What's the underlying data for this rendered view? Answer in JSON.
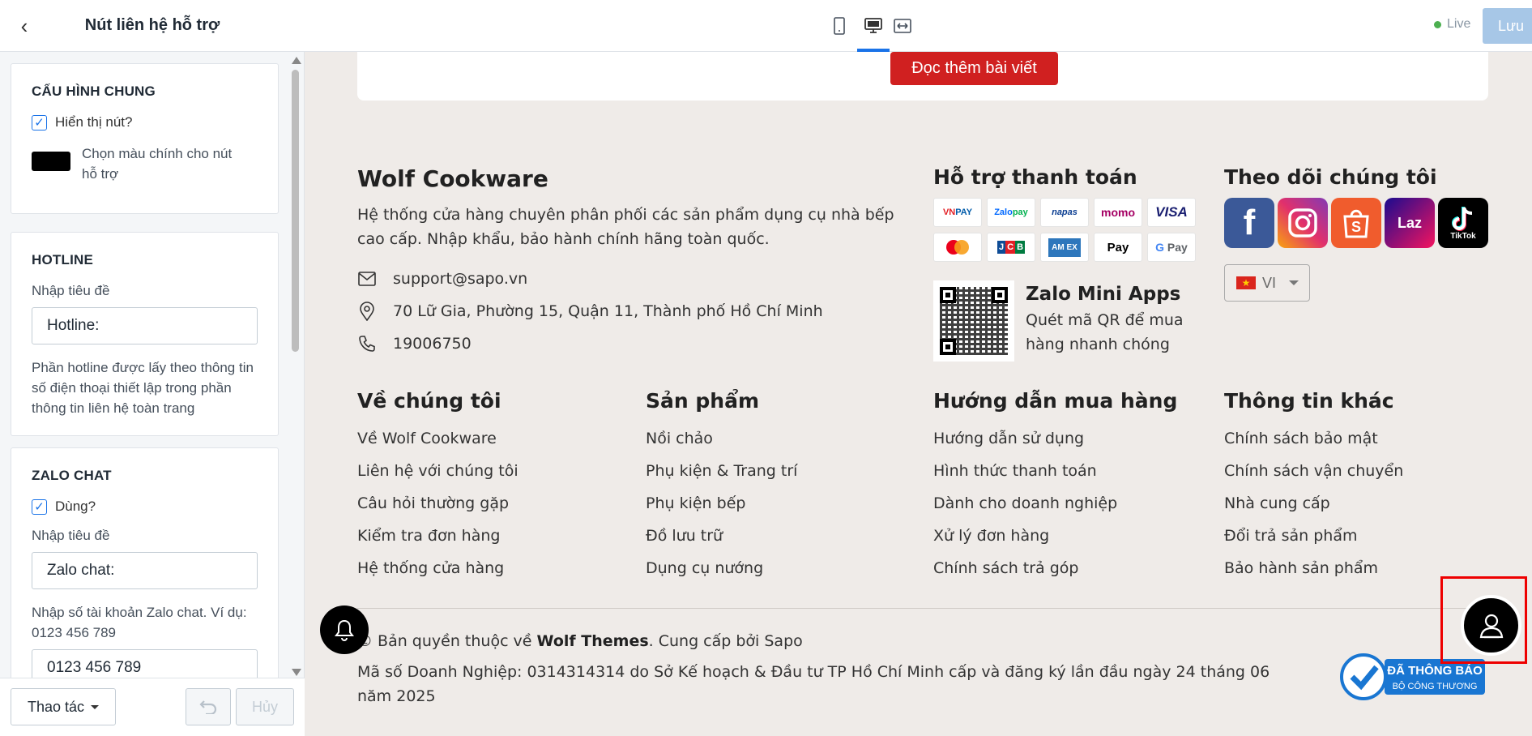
{
  "panel": {
    "title": "Nút liên hệ hỗ trợ",
    "general": {
      "heading": "CẤU HÌNH CHUNG",
      "show_button_label": "Hiển thị nút?",
      "show_button_checked": true,
      "color_label": "Chọn màu chính cho nút hỗ trợ",
      "color_value": "#000000"
    },
    "hotline": {
      "heading": "HOTLINE",
      "title_label": "Nhập tiêu đề",
      "title_value": "Hotline:",
      "help": "Phần hotline được lấy theo thông tin số điện thoại thiết lập trong phần thông tin liên hệ toàn trang"
    },
    "zalo": {
      "heading": "ZALO CHAT",
      "use_label": "Dùng?",
      "use_checked": true,
      "title_label": "Nhập tiêu đề",
      "title_value": "Zalo chat:",
      "account_label": "Nhập số tài khoản Zalo chat. Ví dụ: 0123 456 789",
      "account_value": "0123 456 789"
    },
    "footer": {
      "actions_label": "Thao tác",
      "cancel_label": "Hủy"
    }
  },
  "topbar": {
    "live_label": "Live",
    "save_label": "Lưu",
    "active_device": "desktop"
  },
  "preview": {
    "read_more": "Đọc thêm bài viết",
    "brand": {
      "name": "Wolf Cookware",
      "description": "Hệ thống cửa hàng chuyên phân phối các sản phẩm dụng cụ nhà bếp cao cấp. Nhập khẩu, bảo hành chính hãng toàn quốc."
    },
    "contact": {
      "email": "support@sapo.vn",
      "address": "70 Lữ Gia, Phường 15, Quận 11, Thành phố Hồ Chí Minh",
      "phone": "19006750"
    },
    "payment": {
      "heading": "Hỗ trợ thanh toán",
      "methods": [
        "VNPAY",
        "ZaloPay",
        "napas",
        "momo",
        "VISA",
        "Mastercard",
        "JCB",
        "AMEX",
        "Apple Pay",
        "G Pay"
      ]
    },
    "zalo_mini": {
      "heading": "Zalo Mini Apps",
      "text": "Quét mã QR để mua hàng nhanh chóng"
    },
    "follow": {
      "heading": "Theo dõi chúng tôi",
      "networks": [
        "facebook",
        "instagram",
        "shopee",
        "lazada",
        "tiktok"
      ],
      "lazada_label": "Laz",
      "tiktok_label": "TikTok",
      "language": "VI"
    },
    "menus": [
      {
        "heading": "Về chúng tôi",
        "items": [
          "Về Wolf Cookware",
          "Liên hệ với chúng tôi",
          "Câu hỏi thường gặp",
          "Kiểm tra đơn hàng",
          "Hệ thống cửa hàng"
        ]
      },
      {
        "heading": "Sản phẩm",
        "items": [
          "Nồi chảo",
          "Phụ kiện & Trang trí",
          "Phụ kiện bếp",
          "Đồ lưu trữ",
          "Dụng cụ nướng"
        ]
      },
      {
        "heading": "Hướng dẫn mua hàng",
        "items": [
          "Hướng dẫn sử dụng",
          "Hình thức thanh toán",
          "Dành cho doanh nghiệp",
          "Xử lý đơn hàng",
          "Chính sách trả góp"
        ]
      },
      {
        "heading": "Thông tin khác",
        "items": [
          "Chính sách bảo mật",
          "Chính sách vận chuyển",
          "Nhà cung cấp",
          "Đổi trả sản phẩm",
          "Bảo hành sản phẩm"
        ]
      }
    ],
    "copyright": {
      "prefix": "© Bản quyền thuộc về ",
      "owner": "Wolf Themes",
      "suffix": ". Cung cấp bởi Sapo"
    },
    "company_info": "Mã số Doanh Nghiệp: 0314314314 do Sở Kế hoạch & Đầu tư TP Hồ Chí Minh cấp và đăng ký lần đầu ngày 24 tháng 06 năm 2025",
    "gov_badge": {
      "line1": "ĐÃ THÔNG BÁO",
      "line2": "BỘ CÔNG THƯƠNG"
    }
  },
  "colors": {
    "accent": "#1a73e8",
    "read_more_bg": "#d02020",
    "footer_bg": "#efebe8",
    "highlight": "#ee0000"
  }
}
